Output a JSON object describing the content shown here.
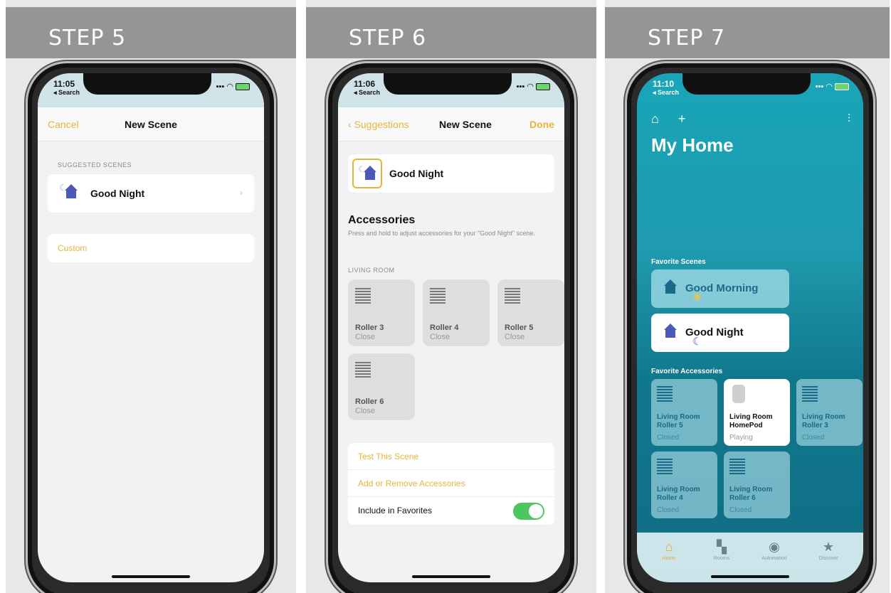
{
  "steps": {
    "step5": "STEP 5",
    "step6": "STEP 6",
    "step7": "STEP 7"
  },
  "phone5": {
    "time": "11:05",
    "back": "◂ Search",
    "nav_left": "Cancel",
    "nav_title": "New Scene",
    "suggested_caption": "SUGGESTED SCENES",
    "scene_name": "Good Night",
    "custom": "Custom"
  },
  "phone6": {
    "time": "11:06",
    "back": "◂ Search",
    "nav_left": "Suggestions",
    "nav_title": "New Scene",
    "nav_right": "Done",
    "scene_name": "Good Night",
    "accessories_title": "Accessories",
    "accessories_desc": "Press and hold to adjust accessories for your \"Good Night\" scene.",
    "room_caption": "LIVING ROOM",
    "tiles": [
      {
        "name": "Roller 3",
        "state": "Close"
      },
      {
        "name": "Roller 4",
        "state": "Close"
      },
      {
        "name": "Roller 5",
        "state": "Close"
      },
      {
        "name": "Roller 6",
        "state": "Close"
      }
    ],
    "test_scene": "Test This Scene",
    "add_remove": "Add or Remove Accessories",
    "include_favorites": "Include in Favorites",
    "include_favorites_on": true
  },
  "phone7": {
    "time": "11:10",
    "back": "◂ Search",
    "title": "My Home",
    "favorite_scenes_caption": "Favorite Scenes",
    "scene_morning": "Good Morning",
    "scene_night": "Good Night",
    "favorite_accessories_caption": "Favorite Accessories",
    "accessories": [
      {
        "line1": "Living Room",
        "line2": "Roller 5",
        "state": "Closed"
      },
      {
        "line1": "Living Room",
        "line2": "HomePod",
        "state": "Playing"
      },
      {
        "line1": "Living Room",
        "line2": "Roller 3",
        "state": "Closed"
      },
      {
        "line1": "Living Room",
        "line2": "Roller 4",
        "state": "Closed"
      },
      {
        "line1": "Living Room",
        "line2": "Roller 6",
        "state": "Closed"
      }
    ],
    "tabs": {
      "home": "Home",
      "rooms": "Rooms",
      "automation": "Automation",
      "discover": "Discover"
    }
  },
  "colors": {
    "accent": "#e6b53c",
    "header_gray": "#959595",
    "toggle_green": "#4cc760",
    "home_teal": "#1f9aae"
  }
}
